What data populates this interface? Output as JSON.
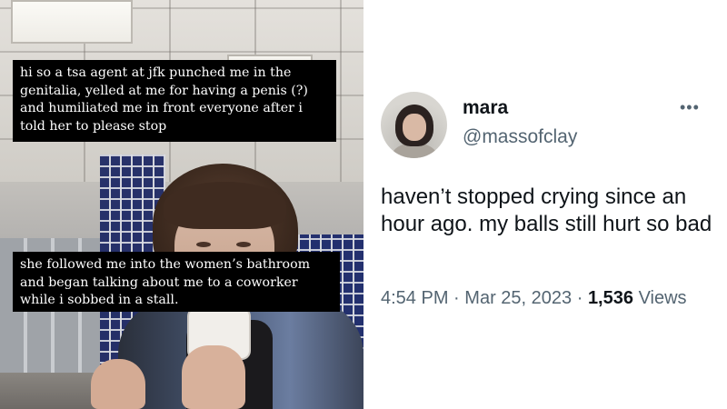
{
  "captions": {
    "first": "hi so a tsa agent at jfk punched me in the\ngenitalia, yelled at me for having a penis (?)\nand humiliated me in front everyone after i\ntold her to please stop",
    "second": "she followed me into the women’s bathroom\nand began talking about me to a coworker\nwhile i sobbed in a stall."
  },
  "tweet": {
    "display_name": "mara",
    "handle": "@massofclay",
    "more_icon": "more-horizontal-icon",
    "more_glyph": "•••",
    "text": "haven’t stopped crying since an hour ago. my balls still hurt so bad",
    "time": "4:54 PM",
    "separator": "·",
    "date": "Mar 25, 2023",
    "views_count": "1,536",
    "views_label": "Views"
  },
  "colors": {
    "caption_bg": "#000000",
    "caption_text": "#ffffff",
    "name_text": "#0f1419",
    "secondary_text": "#536471"
  }
}
